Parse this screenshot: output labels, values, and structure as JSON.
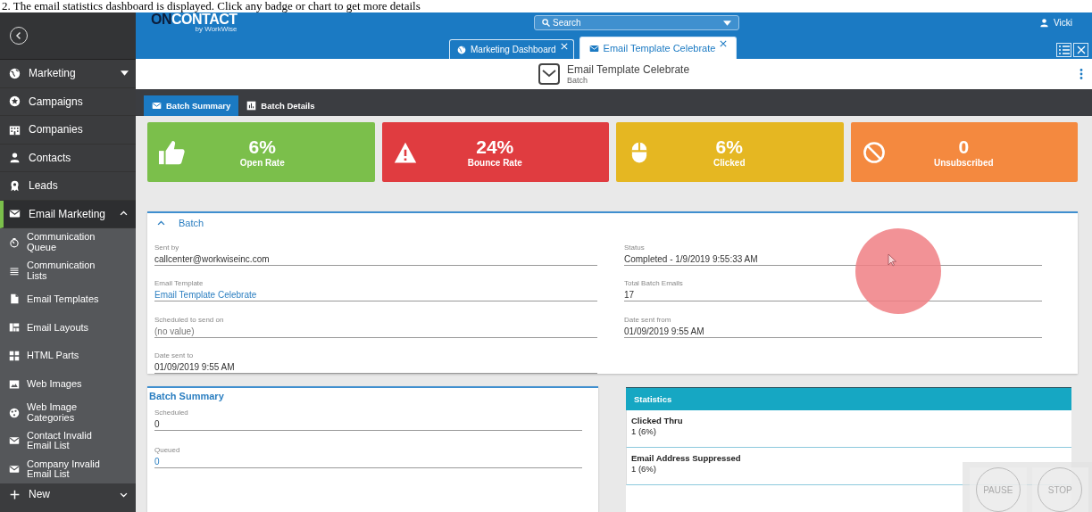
{
  "caption": "2. The email statistics dashboard is displayed. Click any badge or chart to get more details",
  "sidebar": {
    "items": [
      {
        "label": "Marketing",
        "kind": "dropdown",
        "selected": false
      },
      {
        "label": "Campaigns",
        "kind": "link",
        "selected": false
      },
      {
        "label": "Companies",
        "kind": "link",
        "selected": false
      },
      {
        "label": "Contacts",
        "kind": "link",
        "selected": false
      },
      {
        "label": "Leads",
        "kind": "link",
        "selected": false
      },
      {
        "label": "Email Marketing",
        "kind": "group",
        "expanded": true,
        "selected": true,
        "children": [
          {
            "label": "Communication Queue",
            "selected": false
          },
          {
            "label": "Communication Lists",
            "selected": false
          },
          {
            "label": "Email Templates",
            "selected": false
          },
          {
            "label": "Email Layouts",
            "selected": false
          },
          {
            "label": "HTML Parts",
            "selected": false
          },
          {
            "label": "Web Images",
            "selected": false
          },
          {
            "label": "Web Image Categories",
            "selected": false
          },
          {
            "label": "Contact Invalid Email List",
            "selected": false
          },
          {
            "label": "Company Invalid Email List",
            "selected": false
          }
        ]
      },
      {
        "label": "New",
        "kind": "group",
        "expanded": false,
        "selected": false
      }
    ]
  },
  "header": {
    "logo": {
      "prefix": "ON",
      "name": "CONTACT",
      "tagline": "by WorkWise"
    },
    "search": {
      "placeholder": "Search"
    },
    "user": "Vicki",
    "tabs": [
      {
        "label": "Marketing Dashboard",
        "selected": false
      },
      {
        "label": "Email Template Celebrate",
        "selected": true
      }
    ]
  },
  "record": {
    "title": "Email Template Celebrate",
    "subtitle": "Batch",
    "tabs": [
      {
        "label": "Batch Summary",
        "selected": true
      },
      {
        "label": "Batch Details",
        "selected": false
      }
    ]
  },
  "badges": [
    {
      "value": "6%",
      "label": "Open Rate",
      "color": "#7bbf4b"
    },
    {
      "value": "24%",
      "label": "Bounce Rate",
      "color": "#e03c40"
    },
    {
      "value": "6%",
      "label": "Clicked",
      "color": "#e5b722"
    },
    {
      "value": "0",
      "label": "Unsubscribed",
      "color": "#f4893f"
    }
  ],
  "batch": {
    "title": "Batch",
    "expanded": true,
    "left": [
      {
        "label": "Sent by",
        "value": "callcenter@workwiseinc.com",
        "kind": "text"
      },
      {
        "label": "Email Template",
        "value": "Email Template Celebrate",
        "kind": "link"
      },
      {
        "label": "Scheduled to send on",
        "value": "(no value)",
        "kind": "empty"
      },
      {
        "label": "Date sent to",
        "value": "01/09/2019 9:55 AM",
        "kind": "text"
      }
    ],
    "right": [
      {
        "label": "Status",
        "value": "Completed - 1/9/2019 9:55:33 AM",
        "kind": "text"
      },
      {
        "label": "Total Batch Emails",
        "value": "17",
        "kind": "text"
      },
      {
        "label": "Date sent from",
        "value": "01/09/2019 9:55 AM",
        "kind": "text"
      }
    ]
  },
  "batch_summary": {
    "title": "Batch Summary",
    "fields": [
      {
        "label": "Scheduled",
        "value": "0",
        "kind": "text"
      },
      {
        "label": "Queued",
        "value": "0",
        "kind": "link"
      }
    ]
  },
  "statistics": {
    "title": "Statistics",
    "items": [
      {
        "label": "Clicked Thru",
        "value": "1 (6%)"
      },
      {
        "label": "Email Address Suppressed",
        "value": "1 (6%)"
      }
    ]
  },
  "recorder": {
    "buttons": [
      "PAUSE",
      "STOP"
    ]
  }
}
